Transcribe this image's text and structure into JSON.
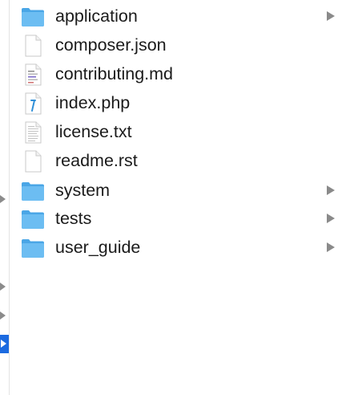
{
  "files": [
    {
      "name": "application",
      "kind": "folder",
      "icon": "folder-icon",
      "has_children": true
    },
    {
      "name": "composer.json",
      "kind": "document",
      "icon": "document-icon",
      "has_children": false
    },
    {
      "name": "contributing.md",
      "kind": "markdown",
      "icon": "markdown-document-icon",
      "has_children": false
    },
    {
      "name": "index.php",
      "kind": "php",
      "icon": "php-document-icon",
      "has_children": false
    },
    {
      "name": "license.txt",
      "kind": "text",
      "icon": "text-document-icon",
      "has_children": false
    },
    {
      "name": "readme.rst",
      "kind": "document",
      "icon": "document-icon",
      "has_children": false
    },
    {
      "name": "system",
      "kind": "folder",
      "icon": "folder-icon",
      "has_children": true
    },
    {
      "name": "tests",
      "kind": "folder",
      "icon": "folder-icon",
      "has_children": true
    },
    {
      "name": "user_guide",
      "kind": "folder",
      "icon": "folder-icon",
      "has_children": true
    }
  ],
  "colors": {
    "folder": "#5fb4ec",
    "selection": "#1b6ae0",
    "disclosure": "#8a8a8a"
  }
}
